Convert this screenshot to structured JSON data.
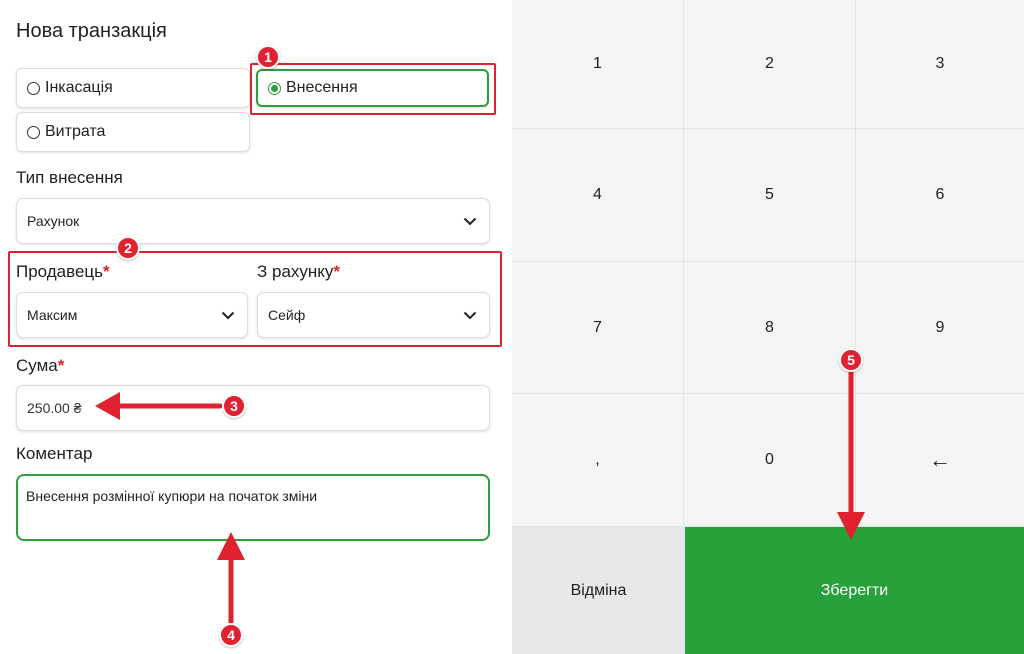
{
  "form": {
    "title": "Нова транзакція",
    "types": [
      {
        "label": "Інкасація",
        "selected": false
      },
      {
        "label": "Внесення",
        "selected": true
      },
      {
        "label": "Витрата",
        "selected": false
      }
    ],
    "deposit_type": {
      "label": "Тип внесення",
      "value": "Рахунок"
    },
    "seller": {
      "label": "Продавець",
      "required_mark": "*",
      "value": "Максим"
    },
    "from_account": {
      "label": "З рахунку",
      "required_mark": "*",
      "value": "Сейф"
    },
    "amount": {
      "label": "Сума",
      "required_mark": "*",
      "value": "250.00 ₴"
    },
    "comment": {
      "label": "Коментар",
      "value": "Внесення розмінної купюри на початок зміни"
    }
  },
  "keypad": {
    "keys": [
      "1",
      "2",
      "3",
      "4",
      "5",
      "6",
      "7",
      "8",
      "9",
      ",",
      "0",
      "←"
    ],
    "cancel_label": "Відміна",
    "save_label": "Зберегти"
  },
  "annotations": {
    "badges": [
      "1",
      "2",
      "3",
      "4",
      "5"
    ],
    "color": "#e0212f"
  },
  "colors": {
    "accent_green": "#28a03c",
    "required": "#e0212f"
  }
}
